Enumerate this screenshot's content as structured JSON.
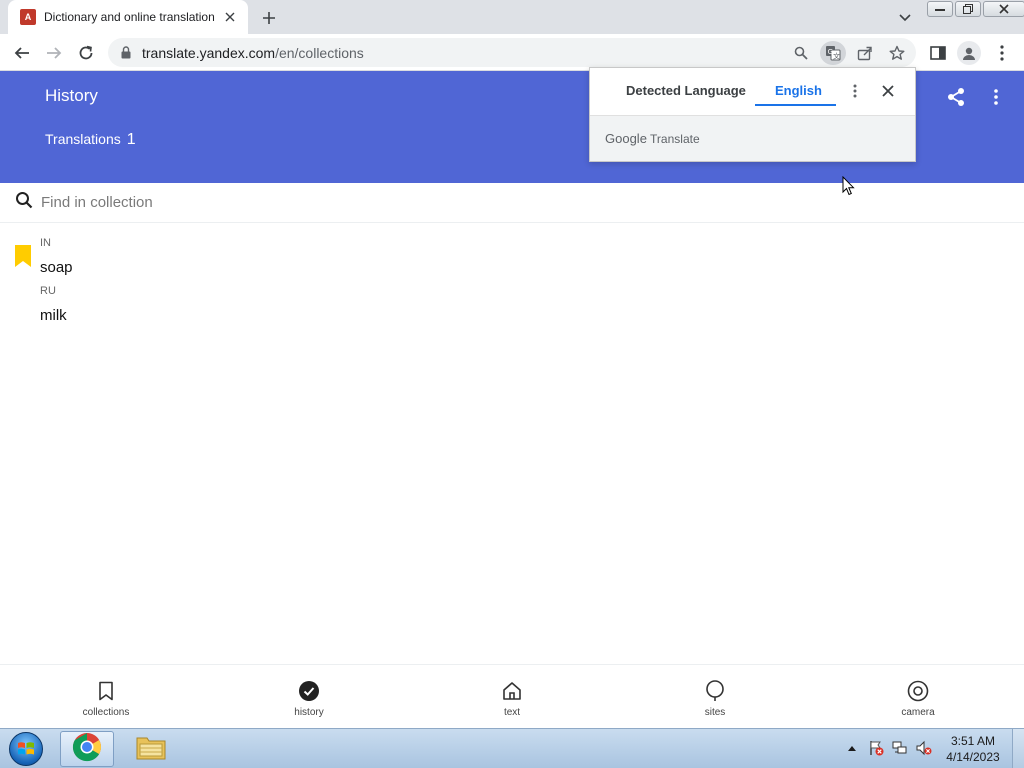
{
  "browser": {
    "tab_title": "Dictionary and online translation",
    "favicon_text": "A",
    "url_host": "translate.yandex.com",
    "url_path": "/en/collections"
  },
  "header": {
    "title": "History",
    "translations_label": "Translations",
    "translations_count": "1",
    "background_color": "#5066d5"
  },
  "search": {
    "placeholder": "Find in collection"
  },
  "entry": {
    "source_lang": "IN",
    "source_word": "soap",
    "target_lang": "RU",
    "target_word": "milk",
    "bookmark_color": "#ffcc00"
  },
  "translate_popup": {
    "tab_detected": "Detected Language",
    "tab_english": "English",
    "brand_google": "Google",
    "brand_translate": "Translate"
  },
  "bottom_nav": [
    {
      "label": "collections",
      "icon": "bookmark-icon"
    },
    {
      "label": "history",
      "icon": "check-circle-icon"
    },
    {
      "label": "text",
      "icon": "home-icon"
    },
    {
      "label": "sites",
      "icon": "bubble-icon"
    },
    {
      "label": "camera",
      "icon": "camera-icon"
    }
  ],
  "taskbar": {
    "time": "3:51 AM",
    "date": "4/14/2023"
  }
}
